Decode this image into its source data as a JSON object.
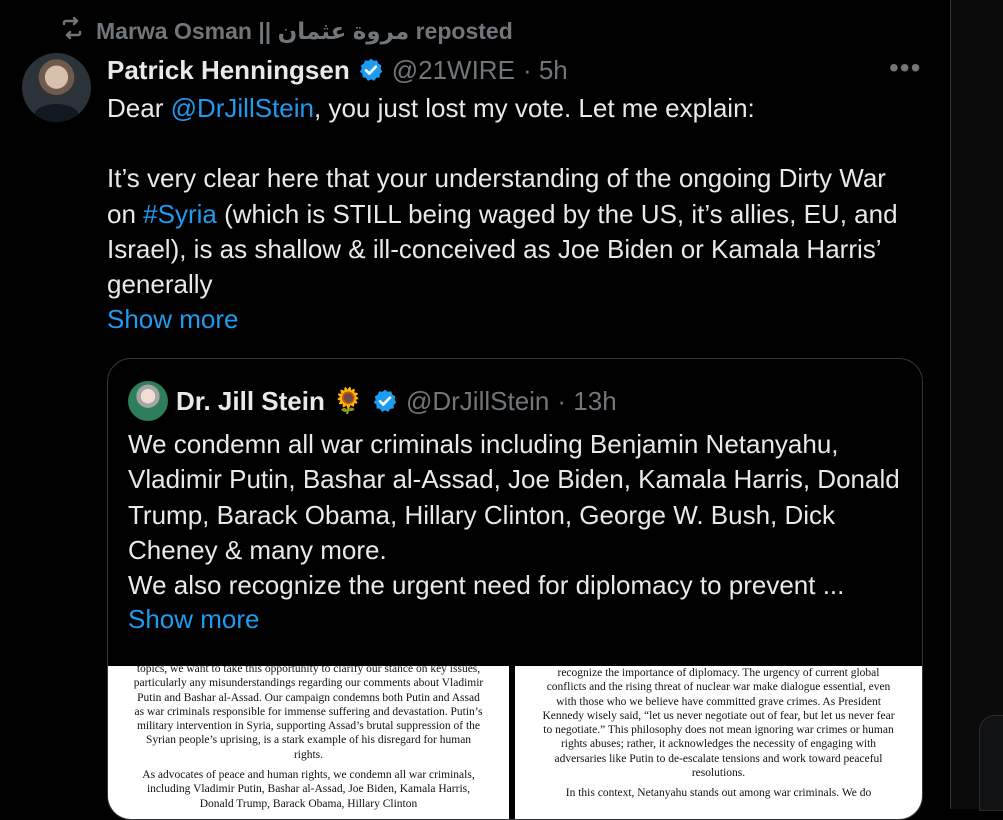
{
  "repost": {
    "label": "Marwa Osman || مروة عثمان reposted",
    "icon": "repost-icon"
  },
  "tweet": {
    "author_name": "Patrick Henningsen",
    "handle": "@21WIRE",
    "time": "· 5h",
    "verified_icon": "verified-badge-icon",
    "text_1_prefix": "Dear ",
    "text_1_mention": "@DrJillStein",
    "text_1_suffix": ", you just lost my vote. Let me explain:",
    "text_2_prefix": "It’s very clear here that your understanding of the ongoing Dirty War on ",
    "text_2_hashtag": "#Syria",
    "text_2_suffix": " (which is STILL being waged by the US, it’s allies, EU, and Israel), is as shallow & ill-conceived as Joe Biden or Kamala Harris’ generally",
    "show_more": "Show more"
  },
  "quote": {
    "author_name": "Dr. Jill Stein",
    "emoji": "🌻",
    "handle": "@DrJillStein",
    "time": "· 13h",
    "text_1": "We condemn all war criminals including Benjamin Netanyahu, Vladimir Putin, Bashar al-Assad, Joe Biden, Kamala Harris, Donald Trump, Barack Obama, Hillary Clinton, George W. Bush, Dick Cheney & many more.",
    "text_2": "We also recognize the urgent need for diplomacy to prevent ...",
    "show_more": "Show more"
  },
  "media": {
    "left_page_1": "topics, we want to take this opportunity to clarify our stance on key issues, particularly any misunderstandings regarding our comments about Vladimir Putin and Bashar al-Assad. Our campaign condemns both Putin and Assad as war criminals responsible for immense suffering and devastation. Putin’s military intervention in Syria, supporting Assad’s brutal suppression of the Syrian people’s uprising, is a stark example of his disregard for human rights.",
    "left_page_2": "As advocates of peace and human rights, we condemn all war criminals, including Vladimir Putin, Bashar al-Assad, Joe Biden, Kamala Harris, Donald Trump, Barack Obama, Hillary Clinton",
    "right_page_1": "recognize the importance of diplomacy. The urgency of current global conflicts and the rising threat of nuclear war make dialogue essential, even with those who we believe have committed grave crimes. As President Kennedy wisely said, “let us never negotiate out of fear, but let us never fear to negotiate.” This philosophy does not mean ignoring war crimes or human rights abuses; rather, it acknowledges the necessity of engaging with adversaries like Putin to de-escalate tensions and work toward peaceful resolutions.",
    "right_page_2": "In this context, Netanyahu stands out among war criminals. We do"
  },
  "colors": {
    "background": "#000000",
    "text": "#e7e9ea",
    "muted": "#71767b",
    "link": "#1d9bf0",
    "verified": "#1d9bf0",
    "border": "#333639"
  }
}
